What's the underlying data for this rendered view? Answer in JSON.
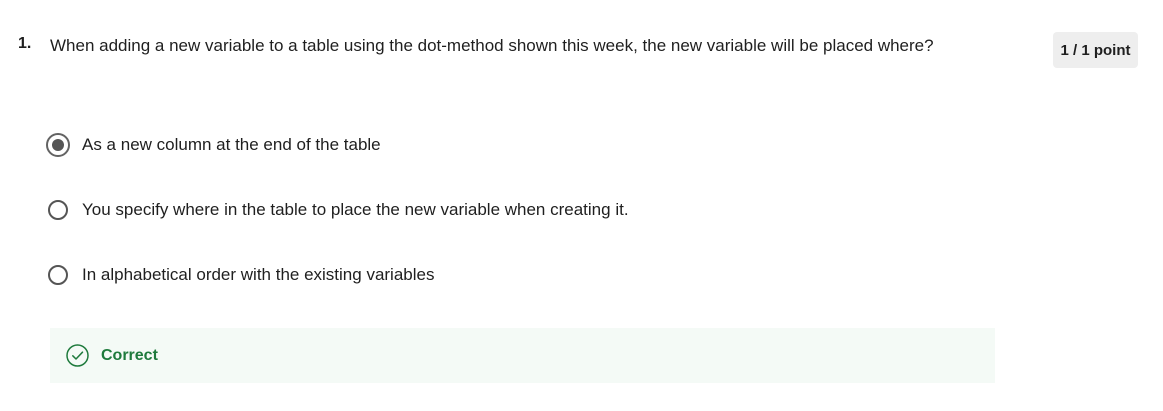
{
  "question": {
    "number": "1.",
    "text": "When adding a new variable to a table using the dot-method shown this week, the new variable will be placed where?",
    "points": "1 / 1 point"
  },
  "options": [
    {
      "label": "As a new column at the end of the table",
      "selected": true
    },
    {
      "label": "You specify where in the table to place the new variable when creating it.",
      "selected": false
    },
    {
      "label": "In alphabetical order with the existing variables",
      "selected": false
    }
  ],
  "feedback": {
    "label": "Correct",
    "icon": "check-circle-icon",
    "color": "#1e7a3c",
    "background": "#f4faf6"
  }
}
